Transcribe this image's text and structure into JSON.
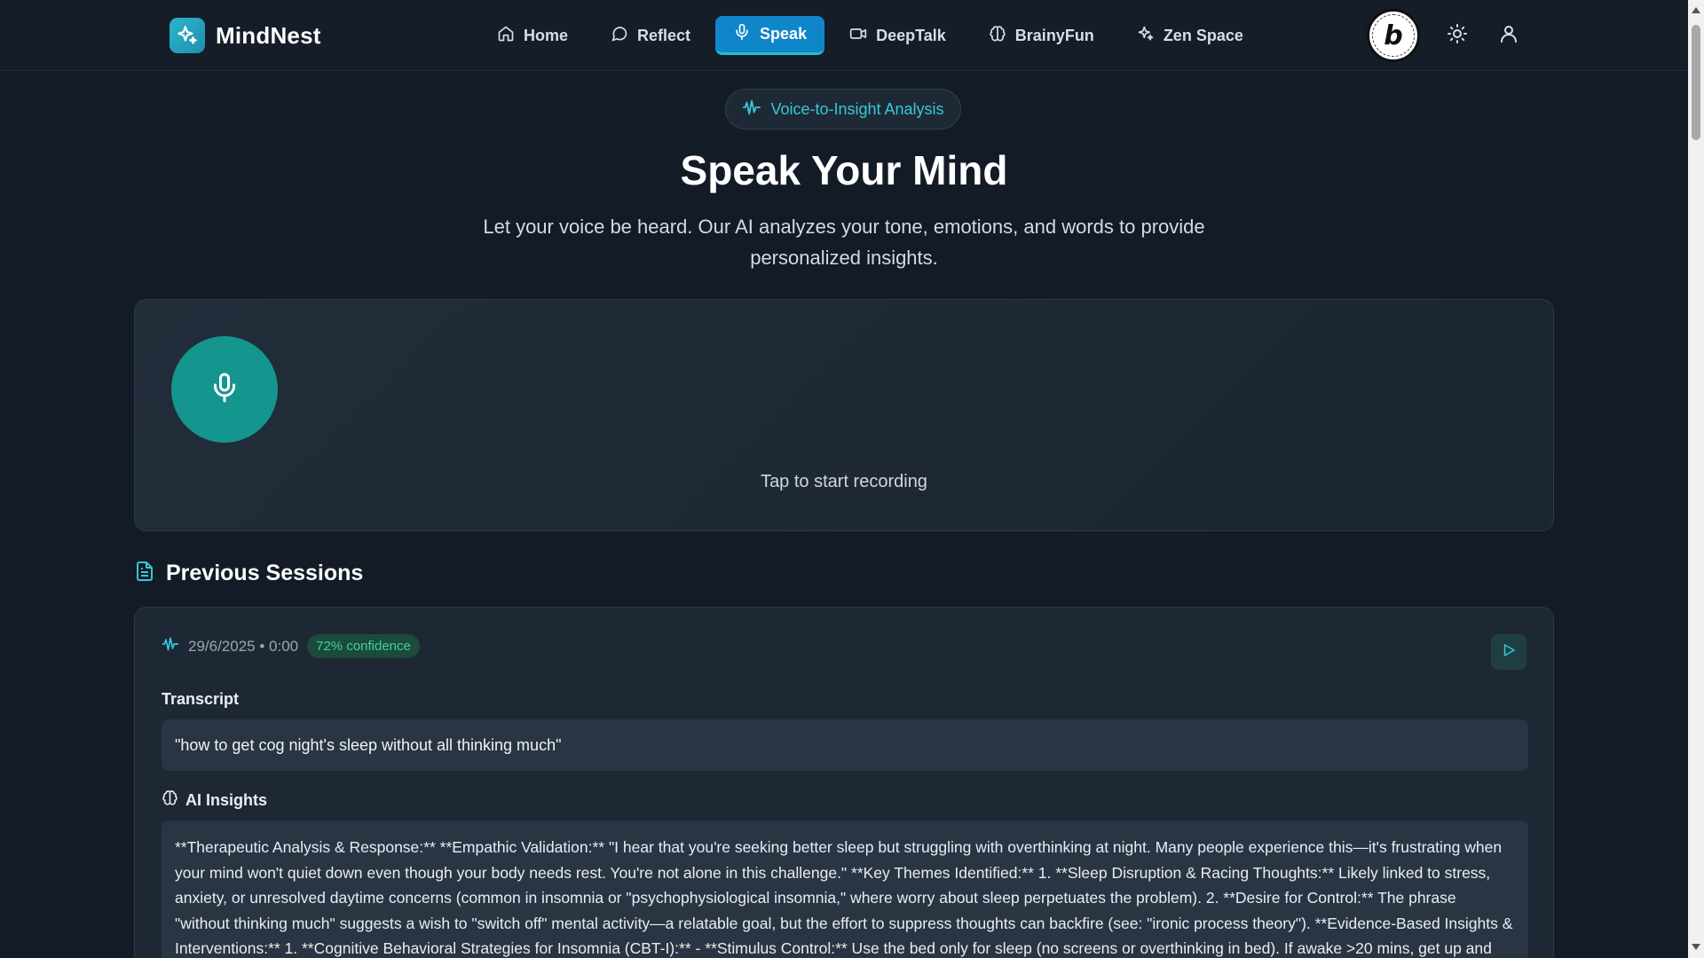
{
  "brand": {
    "name": "MindNest",
    "logo_icon": "sparkles-icon",
    "logo_color": "#2bb6c9"
  },
  "nav": {
    "items": [
      {
        "label": "Home",
        "icon": "home-icon",
        "active": false
      },
      {
        "label": "Reflect",
        "icon": "chat-bubble-icon",
        "active": false
      },
      {
        "label": "Speak",
        "icon": "microphone-icon",
        "active": true
      },
      {
        "label": "DeepTalk",
        "icon": "video-camera-icon",
        "active": false
      },
      {
        "label": "BrainyFun",
        "icon": "brain-icon",
        "active": false
      },
      {
        "label": "Zen Space",
        "icon": "sparkles-icon",
        "active": false
      }
    ],
    "badge_letter": "b"
  },
  "hero": {
    "pill": "Voice-to-Insight Analysis",
    "title": "Speak Your Mind",
    "subtitle": "Let your voice be heard. Our AI analyzes your tone, emotions, and words to provide personalized insights."
  },
  "recorder": {
    "hint": "Tap to start recording"
  },
  "sessions": {
    "title": "Previous Sessions",
    "items": [
      {
        "date": "29/6/2025 • 0:00",
        "confidence": "72% confidence",
        "transcript_label": "Transcript",
        "transcript": "\"how to get cog night's sleep without all thinking much\"",
        "insights_label": "AI Insights",
        "insights": "**Therapeutic Analysis & Response:** **Empathic Validation:** \"I hear that you're seeking better sleep but struggling with overthinking at night. Many people experience this—it's frustrating when your mind won't quiet down even though your body needs rest. You're not alone in this challenge.\" **Key Themes Identified:** 1. **Sleep Disruption & Racing Thoughts:** Likely linked to stress, anxiety, or unresolved daytime concerns (common in insomnia or \"psychophysiological insomnia,\" where worry about sleep perpetuates the problem). 2. **Desire for Control:** The phrase \"without thinking much\" suggests a wish to \"switch off\" mental activity—a relatable goal, but the effort to suppress thoughts can backfire (see: \"ironic process theory\"). **Evidence-Based Insights & Interventions:** 1. **Cognitive Behavioral Strategies for Insomnia (CBT-I):** - **Stimulus Control:** Use the bed only for sleep (no screens or overthinking in bed). If awake >20 mins, get up and"
      }
    ]
  },
  "colors": {
    "background": "#131b27",
    "accent_teal": "#14958d",
    "active_nav": "#0f86c9",
    "confidence_green": "#3fd39a"
  }
}
